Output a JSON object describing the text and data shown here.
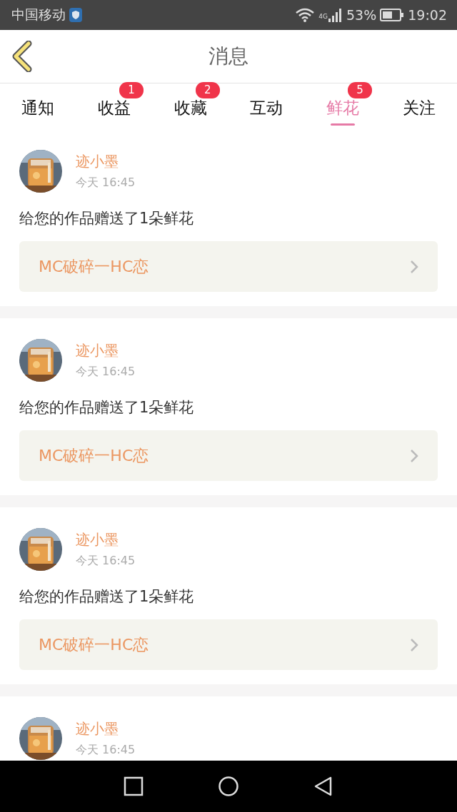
{
  "status_bar": {
    "carrier": "中国移动",
    "network": "4G",
    "battery": "53%",
    "time": "19:02"
  },
  "header": {
    "title": "消息"
  },
  "tabs": [
    {
      "label": "通知",
      "selected": false
    },
    {
      "label": "收益",
      "selected": false,
      "badge": "1"
    },
    {
      "label": "收藏",
      "selected": false,
      "badge": "2"
    },
    {
      "label": "互动",
      "selected": false
    },
    {
      "label": "鲜花",
      "selected": true,
      "badge": "5"
    },
    {
      "label": "关注",
      "selected": false
    }
  ],
  "messages": [
    {
      "name": "迹小墨",
      "time": "今天 16:45",
      "text": "给您的作品赠送了1朵鲜花",
      "work": "MC破碎一HC恋"
    },
    {
      "name": "迹小墨",
      "time": "今天 16:45",
      "text": "给您的作品赠送了1朵鲜花",
      "work": "MC破碎一HC恋"
    },
    {
      "name": "迹小墨",
      "time": "今天 16:45",
      "text": "给您的作品赠送了1朵鲜花",
      "work": "MC破碎一HC恋"
    },
    {
      "name": "迹小墨",
      "time": "今天 16:45"
    }
  ]
}
